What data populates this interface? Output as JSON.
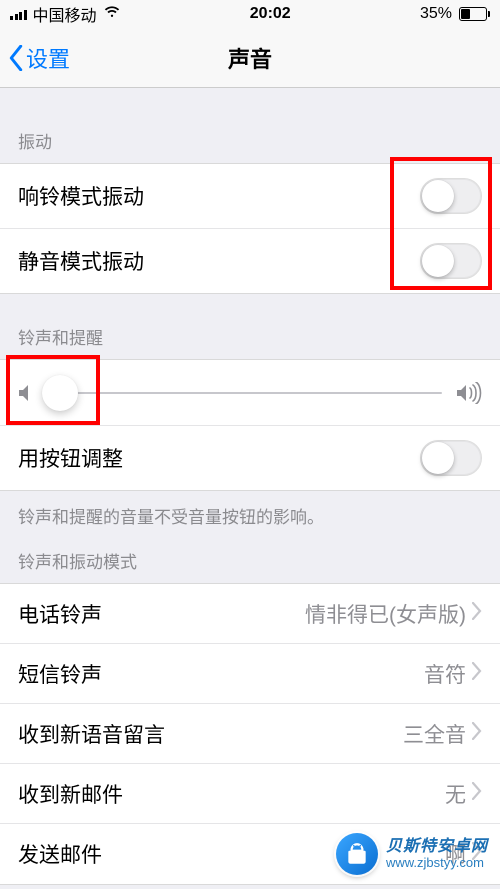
{
  "status": {
    "carrier": "中国移动",
    "time": "20:02",
    "battery_pct": "35%"
  },
  "nav": {
    "back": "设置",
    "title": "声音"
  },
  "sections": {
    "vibration": {
      "header": "振动",
      "ring_mode": "响铃模式振动",
      "silent_mode": "静音模式振动"
    },
    "ringer": {
      "header": "铃声和提醒",
      "adjust_with_buttons": "用按钮调整",
      "footer_note": "铃声和提醒的音量不受音量按钮的影响。"
    },
    "patterns": {
      "header": "铃声和振动模式",
      "items": [
        {
          "label": "电话铃声",
          "value": "情非得已(女声版)"
        },
        {
          "label": "短信铃声",
          "value": "音符"
        },
        {
          "label": "收到新语音留言",
          "value": "三全音"
        },
        {
          "label": "收到新邮件",
          "value": "无"
        },
        {
          "label": "发送邮件",
          "value": "啊"
        }
      ]
    }
  },
  "watermark": {
    "name": "贝斯特安卓网",
    "url": "www.zjbstyy.com"
  }
}
